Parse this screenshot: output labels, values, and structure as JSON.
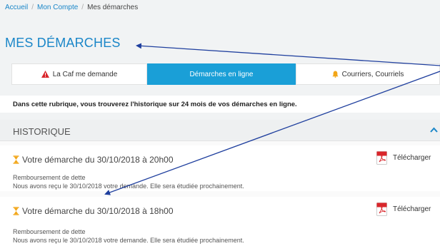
{
  "breadcrumb": {
    "home": "Accueil",
    "account": "Mon Compte",
    "current": "Mes démarches"
  },
  "page_title": "MES DÉMARCHES",
  "tabs": [
    {
      "label": "La Caf me demande",
      "icon": "warning-icon",
      "icon_color": "#d9262b"
    },
    {
      "label": "Démarches en ligne",
      "active": true
    },
    {
      "label": "Courriers, Courriels",
      "icon": "bell-icon",
      "icon_color": "#f2a618"
    }
  ],
  "info_text": "Dans cette rubrique, vous trouverez l'historique sur 24 mois de vos démarches en ligne.",
  "history": {
    "title": "HISTORIQUE",
    "items": [
      {
        "title": "Votre démarche du 30/10/2018 à 20h00",
        "subtitle": "Remboursement de dette",
        "description": "Nous avons reçu le 30/10/2018 votre demande. Elle sera étudiée prochainement.",
        "download_label": "Télécharger"
      },
      {
        "title": "Votre démarche du 30/10/2018 à 18h00",
        "subtitle": "Remboursement de dette",
        "description": "Nous avons reçu le 30/10/2018 votre demande. Elle sera étudiée prochainement.",
        "download_label": "Télécharger"
      }
    ]
  },
  "colors": {
    "accent": "#1a86c8",
    "active_tab": "#1a9fd7",
    "hourglass": "#f2a618",
    "annotation_arrow": "#1f3f9e"
  }
}
